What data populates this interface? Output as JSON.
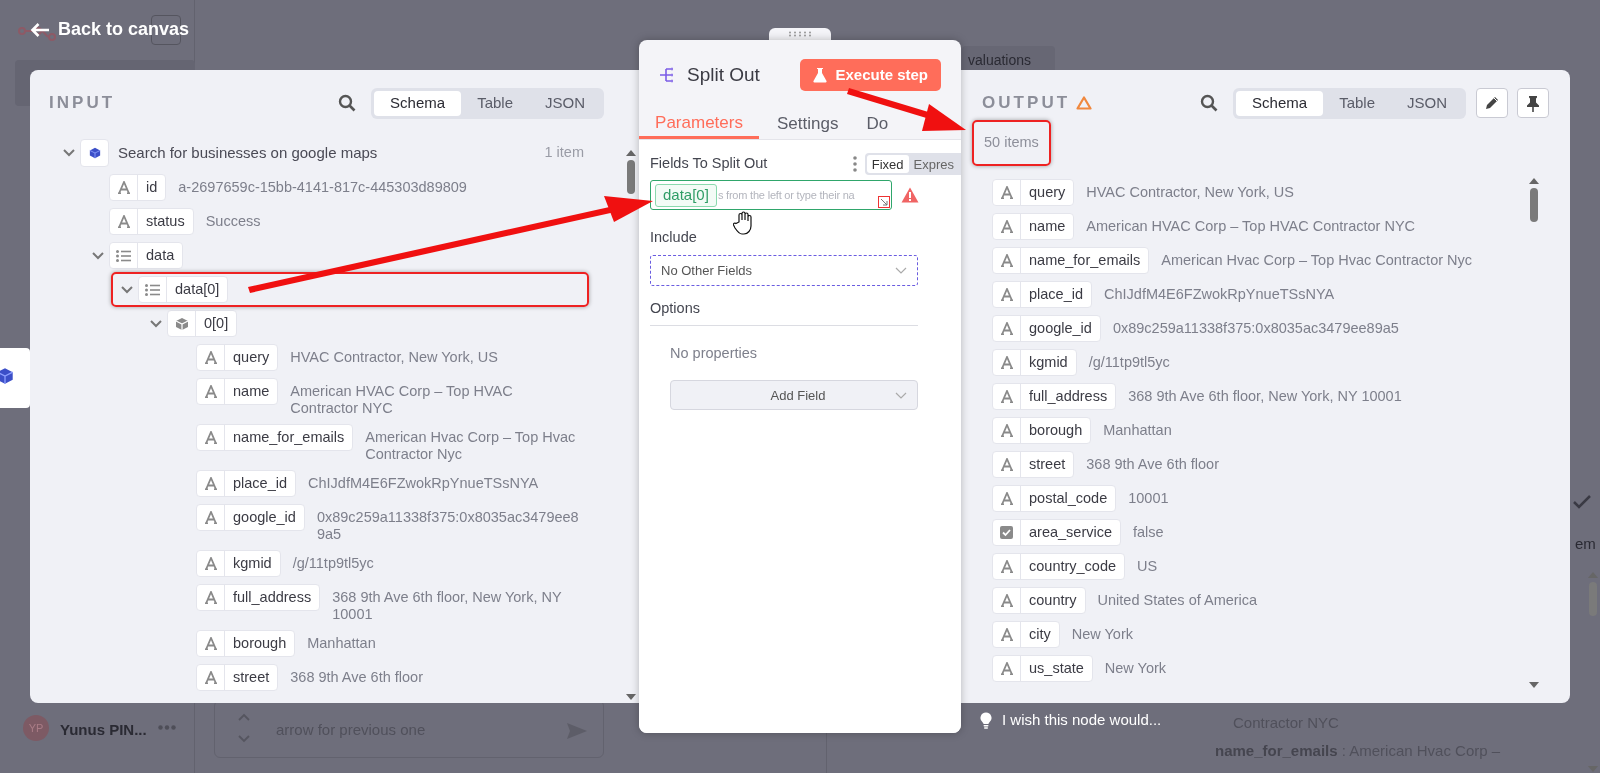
{
  "back_link": {
    "label": "Back to canvas"
  },
  "background": {
    "tab_label": "valuations",
    "user": {
      "initials": "YP",
      "name": "Yunus PIN..."
    },
    "chat_line": "arrow for previous one",
    "preview_lines": [
      {
        "kind": "value",
        "text": "Contractor NYC"
      },
      {
        "kind": "field",
        "key": "name_for_emails",
        "separator": ":",
        "value": "American Hvac Corp –"
      }
    ],
    "list_label": "em"
  },
  "input_panel": {
    "title": "INPUT",
    "view_tabs": [
      {
        "label": "Schema",
        "selected": true
      },
      {
        "label": "Table",
        "selected": false
      },
      {
        "label": "JSON",
        "selected": false
      }
    ],
    "tree": [
      {
        "kind": "node",
        "label": "Search for businesses on google maps",
        "count": "1 item",
        "expanded": true,
        "children": [
          {
            "kind": "string",
            "key": "id",
            "value": "a-2697659c-15bb-4141-817c-445303d89809"
          },
          {
            "kind": "string",
            "key": "status",
            "value": "Success"
          },
          {
            "kind": "list",
            "key": "data",
            "expanded": true,
            "highlighted": false,
            "children": [
              {
                "kind": "list",
                "key": "data[0]",
                "expanded": true,
                "highlighted": true,
                "children": [
                  {
                    "kind": "object",
                    "key": "0[0]",
                    "expanded": true,
                    "highlighted": false,
                    "children": [
                      {
                        "kind": "string",
                        "key": "query",
                        "value": "HVAC Contractor, New York, US"
                      },
                      {
                        "kind": "string",
                        "key": "name",
                        "value": "American HVAC Corp – Top HVAC Contractor NYC"
                      },
                      {
                        "kind": "string",
                        "key": "name_for_emails",
                        "value": "American Hvac Corp – Top Hvac Contractor Nyc"
                      },
                      {
                        "kind": "string",
                        "key": "place_id",
                        "value": "ChIJdfM4E6FZwokRpYnueTSsNYA"
                      },
                      {
                        "kind": "string",
                        "key": "google_id",
                        "value": "0x89c259a11338f375:0x8035ac3479ee89a5"
                      },
                      {
                        "kind": "string",
                        "key": "kgmid",
                        "value": "/g/11tp9tl5yc"
                      },
                      {
                        "kind": "string",
                        "key": "full_address",
                        "value": "368 9th Ave 6th floor, New York, NY 10001"
                      },
                      {
                        "kind": "string",
                        "key": "borough",
                        "value": "Manhattan"
                      },
                      {
                        "kind": "string",
                        "key": "street",
                        "value": "368 9th Ave 6th floor"
                      }
                    ]
                  }
                ]
              }
            ]
          }
        ]
      }
    ]
  },
  "node_panel": {
    "title": "Split Out",
    "execute_button": "Execute step",
    "tabs": [
      {
        "label": "Parameters",
        "selected": true
      },
      {
        "label": "Settings",
        "selected": false
      },
      {
        "label": "Do",
        "selected": false
      }
    ],
    "fields_to_split": {
      "label": "Fields To Split Out",
      "modes": [
        {
          "label": "Fixed",
          "selected": true
        },
        {
          "label": "Expres",
          "selected": false
        }
      ],
      "token": "data[0]",
      "placeholder": "s from the left or type their na",
      "warning": true
    },
    "include": {
      "label": "Include",
      "value": "No Other Fields"
    },
    "options": {
      "label": "Options",
      "empty_text": "No properties",
      "add_button": "Add Field"
    }
  },
  "output_panel": {
    "title": "OUTPUT",
    "warning": true,
    "view_tabs": [
      {
        "label": "Schema",
        "selected": true
      },
      {
        "label": "Table",
        "selected": false
      },
      {
        "label": "JSON",
        "selected": false
      }
    ],
    "count": "50 items",
    "count_highlighted": true,
    "fields": [
      {
        "kind": "string",
        "key": "query",
        "value": "HVAC Contractor, New York, US"
      },
      {
        "kind": "string",
        "key": "name",
        "value": "American HVAC Corp – Top HVAC Contractor NYC"
      },
      {
        "kind": "string",
        "key": "name_for_emails",
        "value": "American Hvac Corp – Top Hvac Contractor Nyc"
      },
      {
        "kind": "string",
        "key": "place_id",
        "value": "ChIJdfM4E6FZwokRpYnueTSsNYA"
      },
      {
        "kind": "string",
        "key": "google_id",
        "value": "0x89c259a11338f375:0x8035ac3479ee89a5"
      },
      {
        "kind": "string",
        "key": "kgmid",
        "value": "/g/11tp9tl5yc"
      },
      {
        "kind": "string",
        "key": "full_address",
        "value": "368 9th Ave 6th floor, New York, NY 10001"
      },
      {
        "kind": "string",
        "key": "borough",
        "value": "Manhattan"
      },
      {
        "kind": "string",
        "key": "street",
        "value": "368 9th Ave 6th floor"
      },
      {
        "kind": "string",
        "key": "postal_code",
        "value": "10001"
      },
      {
        "kind": "boolean",
        "key": "area_service",
        "value": "false"
      },
      {
        "kind": "string",
        "key": "country_code",
        "value": "US"
      },
      {
        "kind": "string",
        "key": "country",
        "value": "United States of America"
      },
      {
        "kind": "string",
        "key": "city",
        "value": "New York"
      },
      {
        "kind": "string",
        "key": "us_state",
        "value": "New York"
      }
    ]
  },
  "feedback": {
    "label": "I wish this node would..."
  }
}
